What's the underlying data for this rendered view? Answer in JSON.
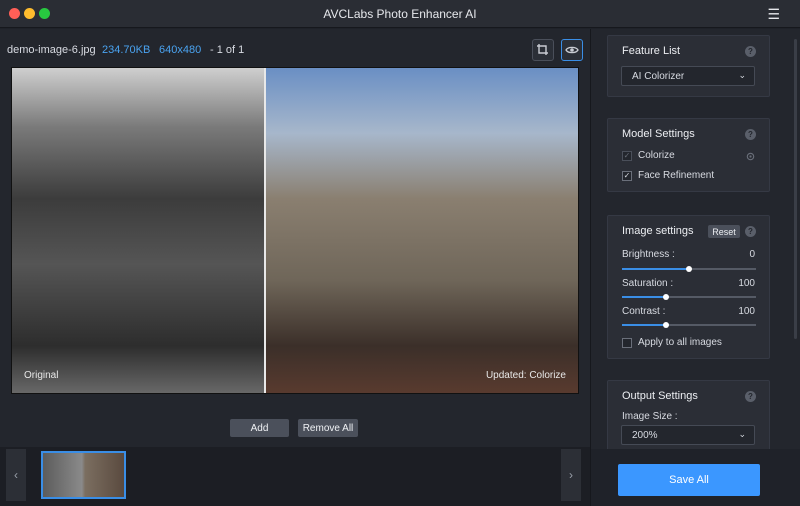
{
  "window": {
    "title": "AVCLabs Photo Enhancer AI",
    "menu_icon": "hamburger-icon"
  },
  "file": {
    "name": "demo-image-6.jpg",
    "size": "234.70KB",
    "dimensions": "640x480",
    "page": "- 1 of 1"
  },
  "preview": {
    "left_label": "Original",
    "right_label": "Updated: Colorize"
  },
  "actions": {
    "add_label": "Add",
    "remove_all_label": "Remove All"
  },
  "feature_list": {
    "title": "Feature List",
    "selected": "AI Colorizer"
  },
  "model_settings": {
    "title": "Model Settings",
    "options": [
      {
        "label": "Colorize",
        "checked": true,
        "enabled": false
      },
      {
        "label": "Face Refinement",
        "checked": true,
        "enabled": true
      }
    ]
  },
  "image_settings": {
    "title": "Image settings",
    "reset_label": "Reset",
    "sliders": [
      {
        "label": "Brightness :",
        "value": "0",
        "fraction": 0.5
      },
      {
        "label": "Saturation :",
        "value": "100",
        "fraction": 0.33
      },
      {
        "label": "Contrast :",
        "value": "100",
        "fraction": 0.33
      }
    ],
    "apply_all_label": "Apply to all images"
  },
  "output_settings": {
    "title": "Output Settings",
    "image_size_label": "Image Size :",
    "image_size_value": "200%"
  },
  "save_all_label": "Save All",
  "colors": {
    "accent": "#3b97ff",
    "link": "#4aa3f0",
    "background": "#23262d"
  }
}
